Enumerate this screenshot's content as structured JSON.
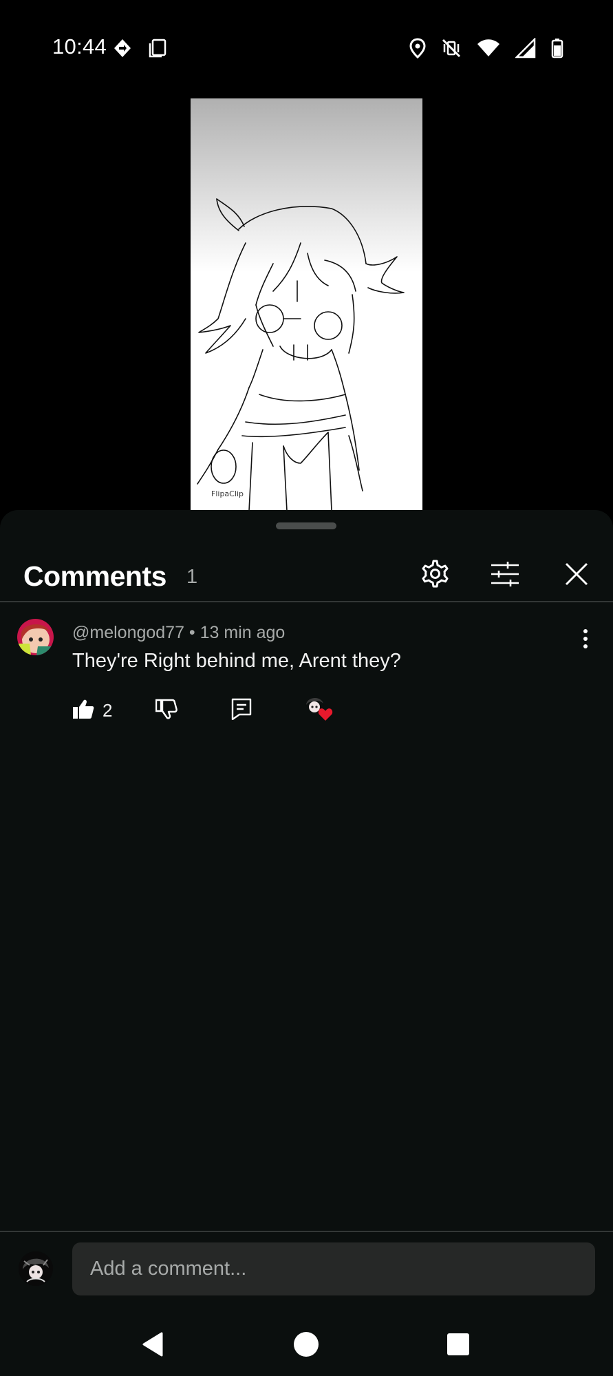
{
  "status_bar": {
    "time": "10:44",
    "left_icons": [
      "navigation-icon",
      "screenshot-icon"
    ],
    "right_icons": [
      "location-icon",
      "vibrate-off-icon",
      "wifi-icon",
      "signal-icon",
      "battery-icon"
    ]
  },
  "video": {
    "watermark": "FlipaClip"
  },
  "comments_panel": {
    "title": "Comments",
    "count": "1",
    "header_icons": [
      "settings-icon",
      "filter-icon",
      "close-icon"
    ],
    "comments": [
      {
        "author": "@melongod77",
        "time": "13 min ago",
        "meta": "@melongod77 • 13 min ago",
        "text": "They're Right behind me, Arent they?",
        "likes": "2",
        "hearted_by_creator": true
      }
    ]
  },
  "composer": {
    "placeholder": "Add a comment..."
  },
  "nav": {
    "buttons": [
      "back-icon",
      "home-icon",
      "recents-icon"
    ]
  },
  "colors": {
    "sheet_bg": "#0b0f0e",
    "heart": "#e8192c",
    "secondary_text": "#a7aaa9",
    "input_bg": "#262827"
  }
}
